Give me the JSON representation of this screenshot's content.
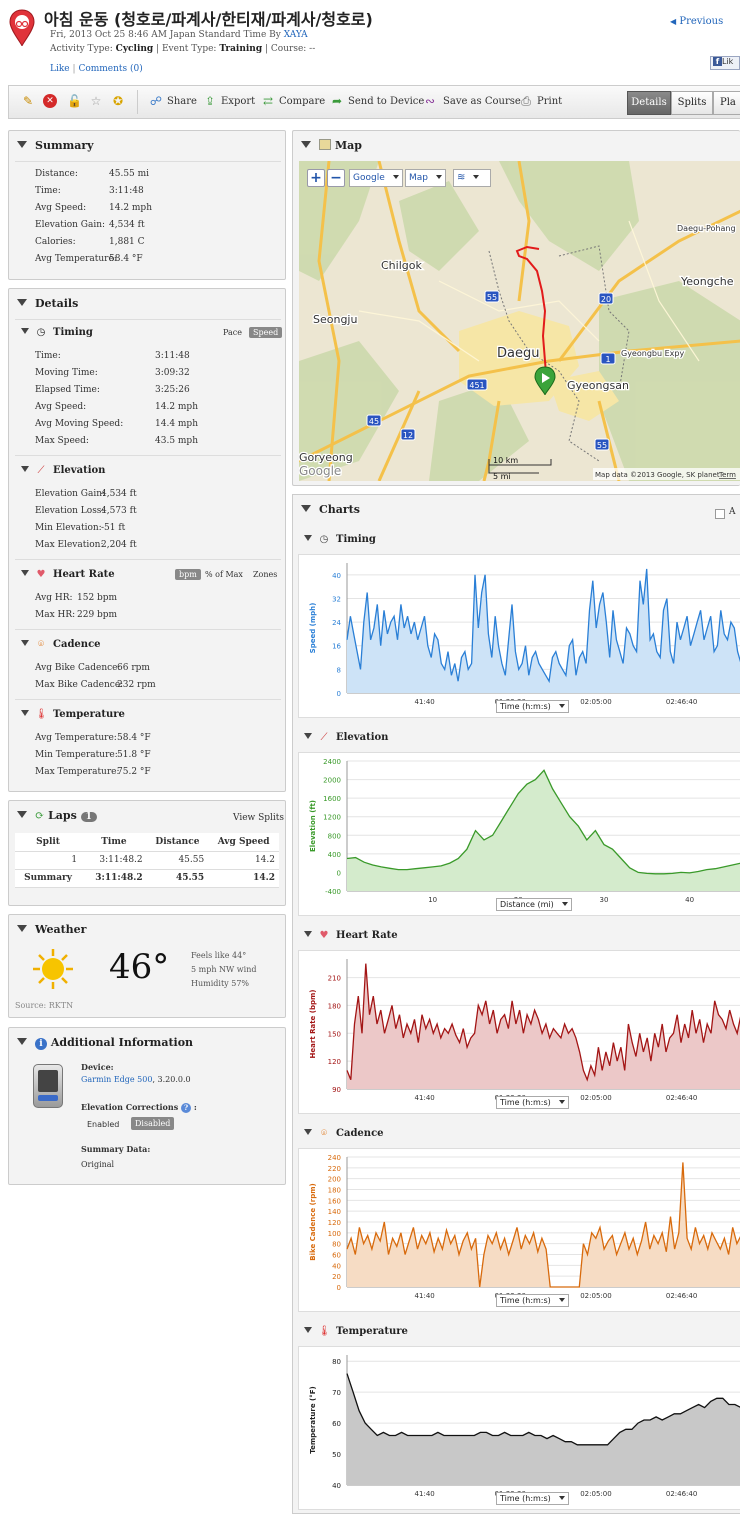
{
  "header": {
    "title": "아침 운동 (청호로/파계사/한티재/파계사/청호로)",
    "date_line": "Fri, 2013 Oct 25 8:46 AM Japan Standard Time By",
    "author": "XAYA",
    "activity_type_label": "Activity Type:",
    "activity_type": "Cycling",
    "event_type_label": "| Event Type:",
    "event_type": "Training",
    "course_label": "| Course: --",
    "like": "Like",
    "comments": "Comments (0)",
    "previous": "Previous",
    "fb_like": "Lik"
  },
  "toolbar": {
    "share": "Share",
    "export": "Export",
    "compare": "Compare",
    "send": "Send to Device",
    "save_course": "Save as Course",
    "print": "Print",
    "tab_details": "Details",
    "tab_splits": "Splits",
    "tab_player": "Pla"
  },
  "summary": {
    "title": "Summary",
    "rows": [
      {
        "label": "Distance:",
        "value": "45.55 mi"
      },
      {
        "label": "Time:",
        "value": "3:11:48"
      },
      {
        "label": "Avg Speed:",
        "value": "14.2 mph"
      },
      {
        "label": "Elevation Gain:",
        "value": "4,534 ft"
      },
      {
        "label": "Calories:",
        "value": "1,881 C"
      },
      {
        "label": "Avg Temperature:",
        "value": "58.4 °F"
      }
    ]
  },
  "details": {
    "title": "Details",
    "timing": {
      "title": "Timing",
      "pace": "Pace",
      "speed": "Speed",
      "rows": [
        {
          "label": "Time:",
          "value": "3:11:48"
        },
        {
          "label": "Moving Time:",
          "value": "3:09:32"
        },
        {
          "label": "Elapsed Time:",
          "value": "3:25:26"
        },
        {
          "label": "Avg Speed:",
          "value": "14.2 mph"
        },
        {
          "label": "Avg Moving Speed:",
          "value": "14.4 mph"
        },
        {
          "label": "Max Speed:",
          "value": "43.5 mph"
        }
      ]
    },
    "elevation": {
      "title": "Elevation",
      "rows": [
        {
          "label": "Elevation Gain:",
          "value": "4,534 ft"
        },
        {
          "label": "Elevation Loss:",
          "value": "4,573 ft"
        },
        {
          "label": "Min Elevation:",
          "value": "-51 ft"
        },
        {
          "label": "Max Elevation:",
          "value": "2,204 ft"
        }
      ]
    },
    "heart_rate": {
      "title": "Heart Rate",
      "bpm": "bpm",
      "pct_max": "% of Max",
      "zones": "Zones",
      "rows": [
        {
          "label": "Avg HR:",
          "value": "152 bpm"
        },
        {
          "label": "Max HR:",
          "value": "229 bpm"
        }
      ]
    },
    "cadence": {
      "title": "Cadence",
      "rows": [
        {
          "label": "Avg Bike Cadence:",
          "value": "66 rpm"
        },
        {
          "label": "Max Bike Cadence:",
          "value": "232 rpm"
        }
      ]
    },
    "temperature": {
      "title": "Temperature",
      "rows": [
        {
          "label": "Avg Temperature:",
          "value": "58.4 °F"
        },
        {
          "label": "Min Temperature:",
          "value": "51.8 °F"
        },
        {
          "label": "Max Temperature:",
          "value": "75.2 °F"
        }
      ]
    }
  },
  "laps": {
    "title": "Laps",
    "count": "1",
    "view_splits": "View Splits",
    "headers": [
      "Split",
      "Time",
      "Distance",
      "Avg Speed"
    ],
    "rows": [
      [
        "1",
        "3:11:48.2",
        "45.55",
        "14.2"
      ]
    ],
    "summary": [
      "Summary",
      "3:11:48.2",
      "45.55",
      "14.2"
    ]
  },
  "weather": {
    "title": "Weather",
    "temp": "46°",
    "feels": "Feels like 44°",
    "wind": "5 mph NW wind",
    "humidity": "Humidity 57%",
    "source": "Source: RKTN"
  },
  "additional": {
    "title": "Additional Information",
    "device_label": "Device:",
    "device_link": "Garmin Edge 500",
    "device_version": ", 3.20.0.0",
    "elev_corr_label": "Elevation Corrections",
    "elev_colon": ":",
    "enabled": "Enabled",
    "disabled": "Disabled",
    "summary_data_label": "Summary Data:",
    "summary_data": "Original"
  },
  "map": {
    "title": "Map",
    "plus": "+",
    "minus": "−",
    "provider": "Google",
    "type": "Map",
    "labels": {
      "chilgok": "Chilgok",
      "seongju": "Seongju",
      "daegu": "Daegu",
      "gyeongsan": "Gyeongsan",
      "yeongche": "Yeongche",
      "goryeong": "Goryeong",
      "expy": "Gyeongbu Expy",
      "daegu_pohang": "Daegu-Pohang",
      "google": "Google"
    },
    "shields": [
      "55",
      "20",
      "1",
      "451",
      "45",
      "12",
      "55"
    ],
    "scale_km": "10 km",
    "scale_mi": "5 mi",
    "attribution": "Map data ©2013 Google, SK planet -",
    "terms": "Term"
  },
  "charts": {
    "title": "Charts",
    "timing_title": "Timing",
    "elevation_title": "Elevation",
    "hr_title": "Heart Rate",
    "cadence_title": "Cadence",
    "temp_title": "Temperature",
    "time_select": "Time (h:m:s)",
    "dist_select": "Distance (mi)",
    "checkbox_label": "A"
  },
  "chart_data": [
    {
      "type": "area",
      "ylabel": "Speed (mph)",
      "color": "#2a7fd6",
      "ylim": [
        0,
        44
      ],
      "yticks": [
        0,
        8,
        16,
        24,
        32,
        40
      ],
      "xticks": [
        "41:40",
        "01:23:20",
        "02:05:00",
        "02:46:40"
      ],
      "values": [
        18,
        26,
        20,
        14,
        8,
        24,
        34,
        18,
        22,
        30,
        16,
        28,
        20,
        24,
        26,
        18,
        30,
        22,
        26,
        20,
        24,
        18,
        22,
        26,
        16,
        12,
        20,
        18,
        10,
        8,
        14,
        6,
        10,
        4,
        12,
        14,
        8,
        10,
        40,
        22,
        34,
        40,
        20,
        12,
        26,
        16,
        10,
        6,
        18,
        30,
        14,
        8,
        10,
        16,
        6,
        12,
        14,
        10,
        8,
        6,
        4,
        12,
        14,
        10,
        8,
        6,
        16,
        18,
        6,
        12,
        14,
        10,
        28,
        38,
        22,
        30,
        34,
        24,
        12,
        28,
        18,
        14,
        10,
        22,
        20,
        16,
        14,
        38,
        30,
        42,
        18,
        20,
        14,
        12,
        28,
        32,
        14,
        10,
        24,
        18,
        22,
        26,
        16,
        20,
        24,
        28,
        18,
        22,
        26,
        14,
        16,
        28,
        20,
        18,
        24,
        22,
        14,
        10
      ]
    },
    {
      "type": "area",
      "ylabel": "Elevation (ft)",
      "color": "#3a9a2a",
      "ylim": [
        -400,
        2400
      ],
      "yticks": [
        -400,
        0,
        400,
        800,
        1200,
        1600,
        2000,
        2400
      ],
      "xticks": [
        10,
        20,
        30,
        40
      ],
      "xlim": [
        0,
        46
      ],
      "x": [
        0,
        1,
        2,
        3,
        4,
        5,
        6,
        7,
        8,
        9,
        10,
        11,
        12,
        13,
        14,
        15,
        16,
        17,
        18,
        19,
        20,
        21,
        22,
        23,
        24,
        25,
        26,
        27,
        28,
        29,
        30,
        31,
        32,
        33,
        34,
        35,
        36,
        37,
        38,
        39,
        40,
        41,
        42,
        43,
        44,
        45,
        46
      ],
      "values": [
        300,
        320,
        220,
        160,
        120,
        90,
        60,
        60,
        80,
        100,
        120,
        140,
        200,
        300,
        500,
        900,
        700,
        800,
        1100,
        1400,
        1700,
        1900,
        2000,
        2200,
        1800,
        1500,
        1200,
        1000,
        700,
        900,
        600,
        500,
        300,
        100,
        0,
        -20,
        -30,
        -30,
        -20,
        0,
        -10,
        20,
        60,
        80,
        120,
        160,
        200
      ]
    },
    {
      "type": "line",
      "ylabel": "Heart Rate (bpm)",
      "color": "#a31515",
      "ylim": [
        90,
        230
      ],
      "yticks": [
        90,
        120,
        150,
        180,
        210
      ],
      "xticks": [
        "41:40",
        "01:23:20",
        "02:05:00",
        "02:46:40"
      ],
      "values": [
        110,
        100,
        160,
        190,
        150,
        225,
        170,
        190,
        160,
        175,
        150,
        165,
        180,
        155,
        170,
        145,
        160,
        150,
        165,
        140,
        170,
        155,
        165,
        150,
        160,
        145,
        155,
        150,
        160,
        148,
        140,
        155,
        135,
        145,
        150,
        180,
        170,
        185,
        160,
        175,
        150,
        165,
        170,
        155,
        185,
        160,
        175,
        150,
        170,
        160,
        175,
        165,
        150,
        160,
        145,
        155,
        150,
        145,
        160,
        150,
        155,
        145,
        130,
        110,
        100,
        115,
        105,
        135,
        110,
        130,
        115,
        140,
        120,
        135,
        110,
        160,
        140,
        125,
        150,
        130,
        145,
        120,
        150,
        135,
        160,
        130,
        145,
        150,
        170,
        140,
        160,
        145,
        175,
        150,
        165,
        140,
        160,
        150,
        185,
        170,
        165,
        155,
        175,
        160,
        150,
        170
      ]
    },
    {
      "type": "line",
      "ylabel": "Bike Cadence (rpm)",
      "color": "#d86a0c",
      "ylim": [
        0,
        240
      ],
      "yticks": [
        0,
        20,
        40,
        60,
        80,
        100,
        120,
        140,
        160,
        180,
        200,
        220,
        240
      ],
      "xticks": [
        "41:40",
        "01:23:20",
        "02:05:00",
        "02:46:40"
      ],
      "values": [
        70,
        90,
        60,
        110,
        80,
        95,
        70,
        100,
        85,
        120,
        60,
        90,
        75,
        100,
        60,
        85,
        110,
        70,
        95,
        80,
        100,
        65,
        90,
        70,
        105,
        80,
        95,
        60,
        85,
        100,
        70,
        90,
        0,
        60,
        95,
        80,
        100,
        70,
        90,
        60,
        85,
        110,
        70,
        95,
        80,
        100,
        65,
        90,
        70,
        0,
        0,
        0,
        0,
        0,
        0,
        0,
        0,
        80,
        60,
        100,
        90,
        110,
        70,
        85,
        95,
        60,
        80,
        100,
        70,
        90,
        60,
        85,
        120,
        70,
        95,
        80,
        100,
        65,
        130,
        70,
        100,
        230,
        90,
        70,
        110,
        80,
        95,
        70,
        100,
        85,
        70,
        90,
        60,
        110,
        80,
        95
      ]
    },
    {
      "type": "area",
      "ylabel": "Temperature (°F)",
      "color": "#111111",
      "ylim": [
        40,
        82
      ],
      "yticks": [
        40,
        50,
        60,
        70,
        80
      ],
      "xticks": [
        "41:40",
        "01:23:20",
        "02:05:00",
        "02:46:40"
      ],
      "values": [
        76,
        70,
        64,
        60,
        58,
        56,
        57,
        56,
        56,
        57,
        56,
        56,
        56,
        56,
        56,
        57,
        56,
        56,
        56,
        56,
        56,
        56,
        57,
        57,
        56,
        56,
        57,
        56,
        56,
        56,
        57,
        56,
        56,
        55,
        56,
        55,
        54,
        54,
        53,
        53,
        53,
        53,
        53,
        53,
        55,
        57,
        58,
        58,
        60,
        61,
        61,
        62,
        61,
        62,
        63,
        63,
        64,
        65,
        66,
        65,
        67,
        68,
        68,
        66,
        66,
        65
      ]
    }
  ]
}
